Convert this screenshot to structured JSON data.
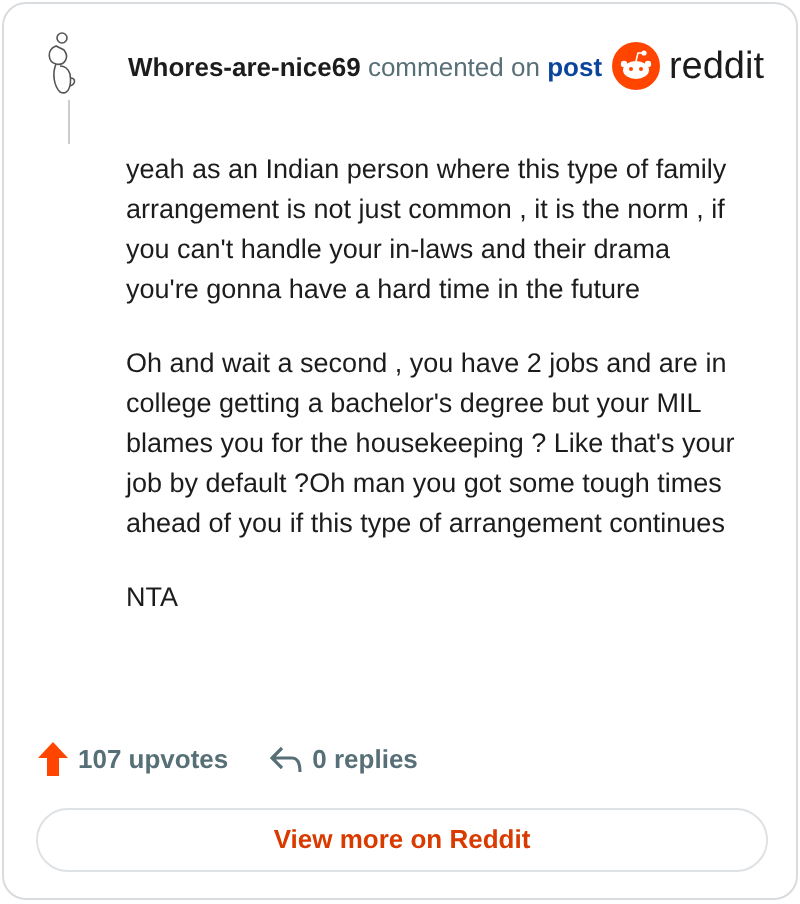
{
  "comment": {
    "author": "Whores-are-nice69",
    "action": "commented on",
    "link": "post",
    "brand": "reddit",
    "paragraphs": [
      "yeah as an Indian person where this type of family arrangement is not just common , it is the norm , if you can't handle your in-laws and their drama you're gonna have a hard time in the future",
      "Oh and wait a second , you have 2 jobs and are in college getting a bachelor's degree but your MIL blames you for the housekeeping ? Like that's your job by default ?Oh man you got some tough times ahead of you if this type of arrangement continues",
      "NTA"
    ]
  },
  "footer": {
    "upvotes": "107 upvotes",
    "replies": "0 replies"
  },
  "button": "View more on Reddit"
}
